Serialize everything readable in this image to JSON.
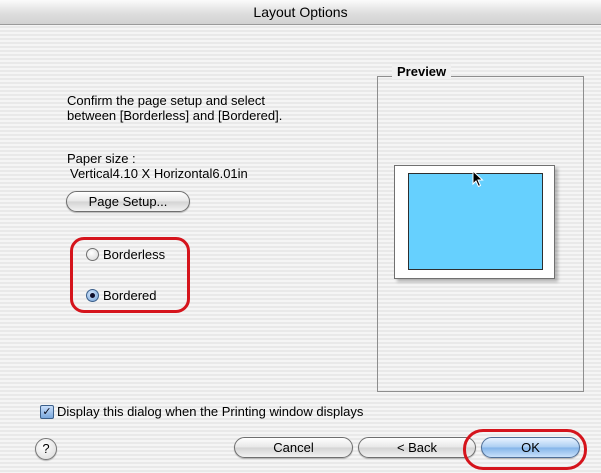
{
  "window": {
    "title": "Layout Options"
  },
  "instructions": {
    "line1": "Confirm the page setup and select",
    "line2": "between [Borderless] and [Bordered]."
  },
  "paper": {
    "label": "Paper size :",
    "value": "Vertical4.10 X Horizontal6.01in"
  },
  "buttons": {
    "page_setup": "Page Setup...",
    "cancel": "Cancel",
    "back": "< Back",
    "ok": "OK",
    "help": "?"
  },
  "layout_options": [
    {
      "label": "Borderless",
      "selected": false
    },
    {
      "label": "Bordered",
      "selected": true
    }
  ],
  "preview": {
    "title": "Preview"
  },
  "display_dialog": {
    "label": "Display this dialog when the Printing window displays",
    "checked": true
  },
  "colors": {
    "annotation_red": "#d5141c",
    "preview_printable_area": "#66d0fe"
  },
  "icons": {
    "cursor": "arrow-cursor-icon",
    "help": "question-mark-icon",
    "check": "checkmark-icon"
  }
}
